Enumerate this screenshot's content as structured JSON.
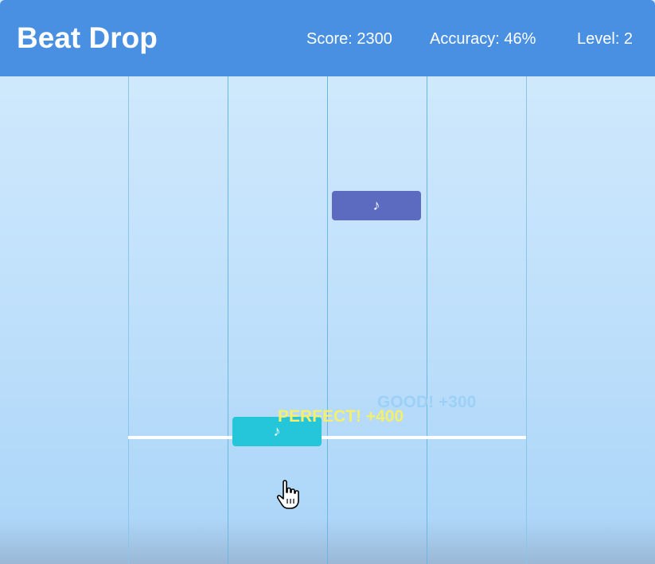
{
  "header": {
    "title": "Beat Drop",
    "score": "Score: 2300",
    "accuracy": "Accuracy: 46%",
    "level": "Level: 2"
  },
  "notes": [
    {
      "lane": 3,
      "symbol": "♪",
      "color": "#5c6bc0"
    },
    {
      "lane": 2,
      "symbol": "♪",
      "color": "#26c6da"
    }
  ],
  "feedback": {
    "good": "GOOD! +300",
    "perfect": "PERFECT! +400"
  },
  "colors": {
    "header": "#4a90e2",
    "lane_divider": "#6ab8e2",
    "hit_line": "#ffffff",
    "good_text": "#9dd0f6",
    "perfect_text": "#f4ef6c"
  },
  "cursor_icon": "hand-pointer-icon"
}
